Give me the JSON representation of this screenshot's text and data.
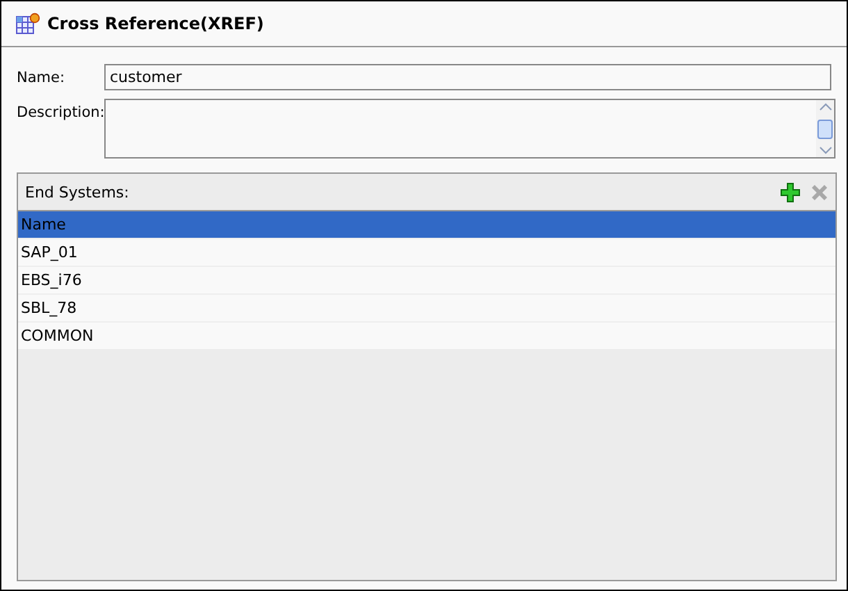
{
  "window": {
    "title": "Cross Reference(XREF)"
  },
  "form": {
    "name": {
      "label": "Name:",
      "value": "customer"
    },
    "description": {
      "label": "Description:"
    }
  },
  "end_systems": {
    "title": "End Systems:",
    "toolbar": [
      {
        "kind": "add",
        "disabled": false
      },
      {
        "kind": "remove",
        "disabled": true
      }
    ],
    "table": {
      "columns": [
        {
          "label": "Name",
          "selected": true
        }
      ],
      "rows": [
        {
          "name": "SAP_01"
        },
        {
          "name": "EBS_i76"
        },
        {
          "name": "SBL_78"
        },
        {
          "name": "COMMON"
        }
      ]
    }
  }
}
